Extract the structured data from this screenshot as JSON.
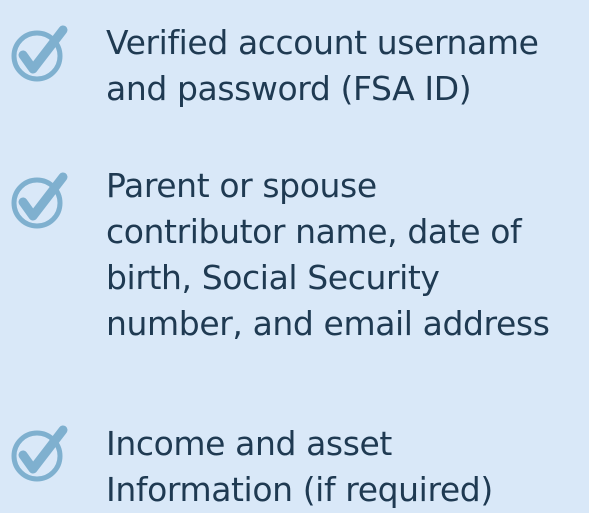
{
  "colors": {
    "background": "#d9e8f8",
    "text": "#1f3a52",
    "check": "#7fb0cf"
  },
  "items": [
    {
      "icon": "check-circle-icon",
      "lines": [
        "Verified account username",
        "and password (FSA ID)"
      ]
    },
    {
      "icon": "check-circle-icon",
      "lines": [
        "Parent or spouse",
        "contributor name, date of",
        "birth, Social Security",
        "number, and email address"
      ]
    },
    {
      "icon": "check-circle-icon",
      "lines": [
        "Income and asset",
        "Information (if required)"
      ]
    }
  ]
}
